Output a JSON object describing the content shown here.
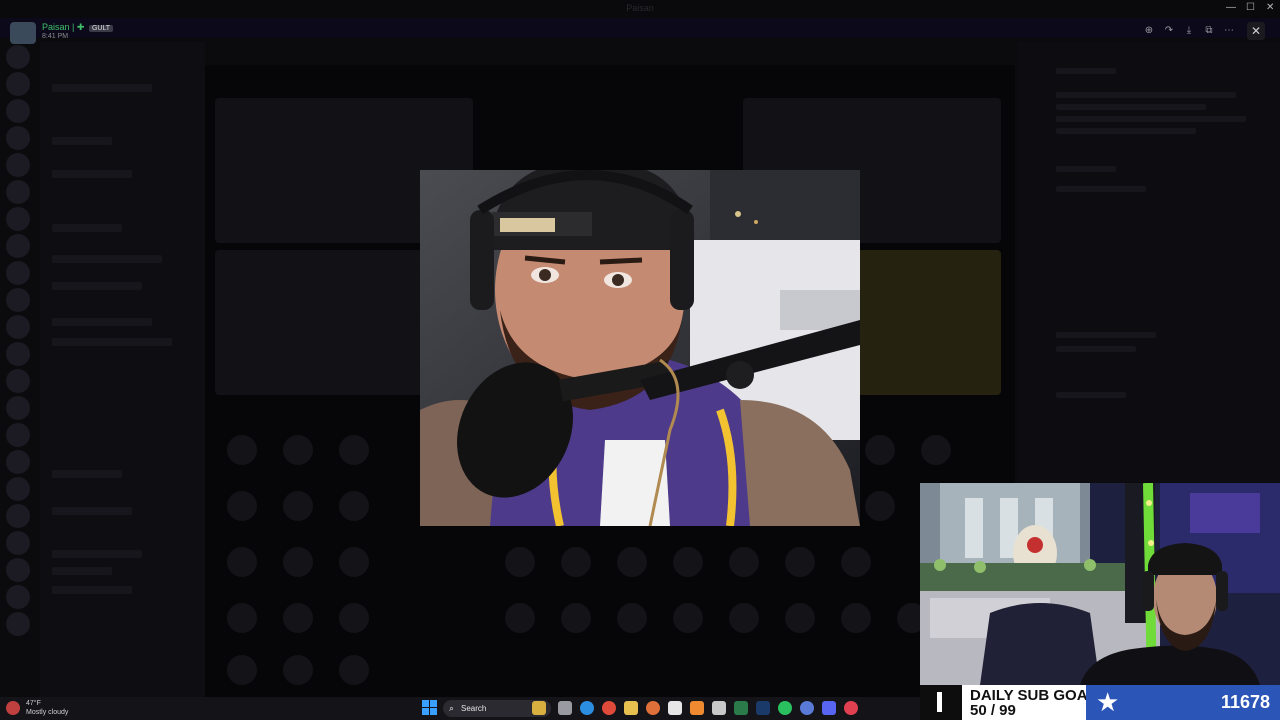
{
  "window": {
    "title": "Paisan",
    "controls": {
      "minimize": "—",
      "maximize": "☐",
      "close": "✕"
    }
  },
  "banner": {
    "text": ""
  },
  "user": {
    "name": "Paisan |",
    "tag": "GULT",
    "time": "8:41 PM"
  },
  "channels": {
    "server_name": ""
  },
  "right_panel": {
    "title": ""
  },
  "stage": {
    "label_speakers": "",
    "label_audience": ""
  },
  "viewer": {
    "tools": [
      "zoom-in-icon",
      "share-icon",
      "download-icon",
      "open-external-icon",
      "more-icon"
    ],
    "close": "✕"
  },
  "overlay": {
    "sub_goal_title": "DAILY SUB GOAL",
    "sub_goal_progress": "50 / 99",
    "sub_goal_fraction": 0.505,
    "counter": "11678",
    "colors": {
      "counter_bg": "#2b56b7",
      "text_bg": "#ffffff"
    }
  },
  "taskbar": {
    "weather_temp": "47°F",
    "weather_desc": "Mostly cloudy",
    "search_label": "Search",
    "apps": [
      "file-explorer-icon",
      "edge-icon",
      "chrome-icon",
      "folder-icon",
      "firefox-icon",
      "store-icon",
      "app-icon",
      "notepad-icon",
      "excel-icon",
      "steam-icon",
      "spotify-icon",
      "app-icon",
      "discord-icon",
      "settings-icon"
    ]
  }
}
